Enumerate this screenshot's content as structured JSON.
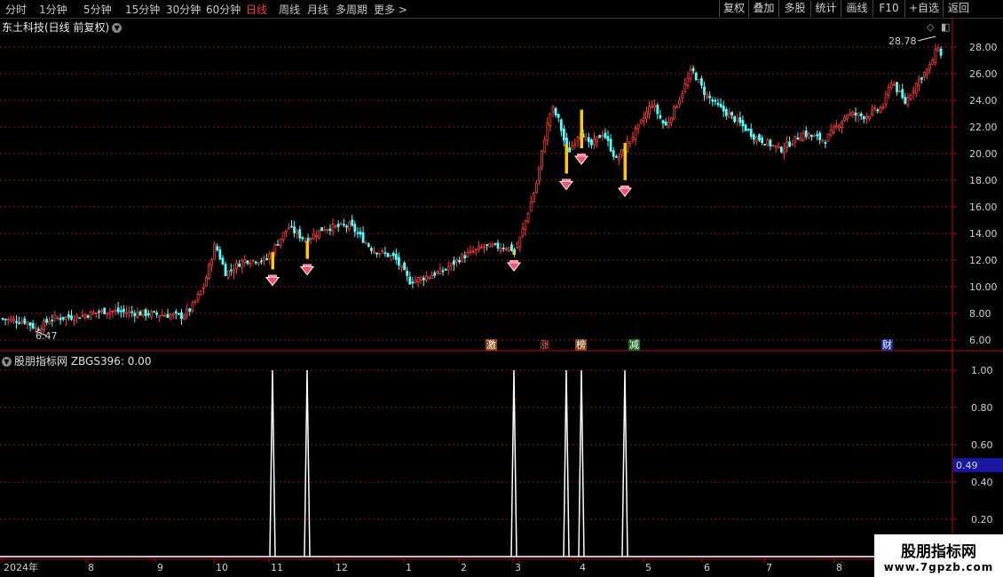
{
  "toolbar": {
    "periods": [
      "分时",
      "1分钟",
      "5分钟",
      "15分钟",
      "30分钟",
      "60分钟",
      "日线",
      "周线",
      "月线",
      "多周期",
      "更多 >"
    ],
    "active_period": "日线",
    "right_buttons": [
      "复权",
      "叠加",
      "多股",
      "统计",
      "画线",
      "F10",
      "+自选",
      "返回"
    ]
  },
  "chart_title": "东土科技(日线 前复权)",
  "main_chart": {
    "price_ticks": [
      "28.00",
      "26.00",
      "24.00",
      "22.00",
      "20.00",
      "18.00",
      "16.00",
      "14.00",
      "12.00",
      "10.00",
      "8.00",
      "6.00"
    ],
    "high_label": "28.78",
    "low_label": "6.47",
    "badges": [
      "激",
      "涨",
      "榜",
      "减",
      "财"
    ]
  },
  "indicator": {
    "title": "股朋指标网 ZBGS396: 0.00",
    "ticks": [
      "1.00",
      "0.80",
      "0.60",
      "0.40",
      "0.20"
    ],
    "current_value": "0.49"
  },
  "time_axis": [
    "2024年",
    "8",
    "9",
    "10",
    "11",
    "12",
    "1",
    "2",
    "3",
    "4",
    "5",
    "6",
    "7",
    "8"
  ],
  "watermark": {
    "line1": "股朋指标网",
    "line2": "www.7gpzb.com"
  },
  "colors": {
    "up": "#ff3c3c",
    "down": "#54ffff",
    "grid": "#7a1a1a",
    "signal": "#ffc800",
    "axis": "#b01010"
  }
}
